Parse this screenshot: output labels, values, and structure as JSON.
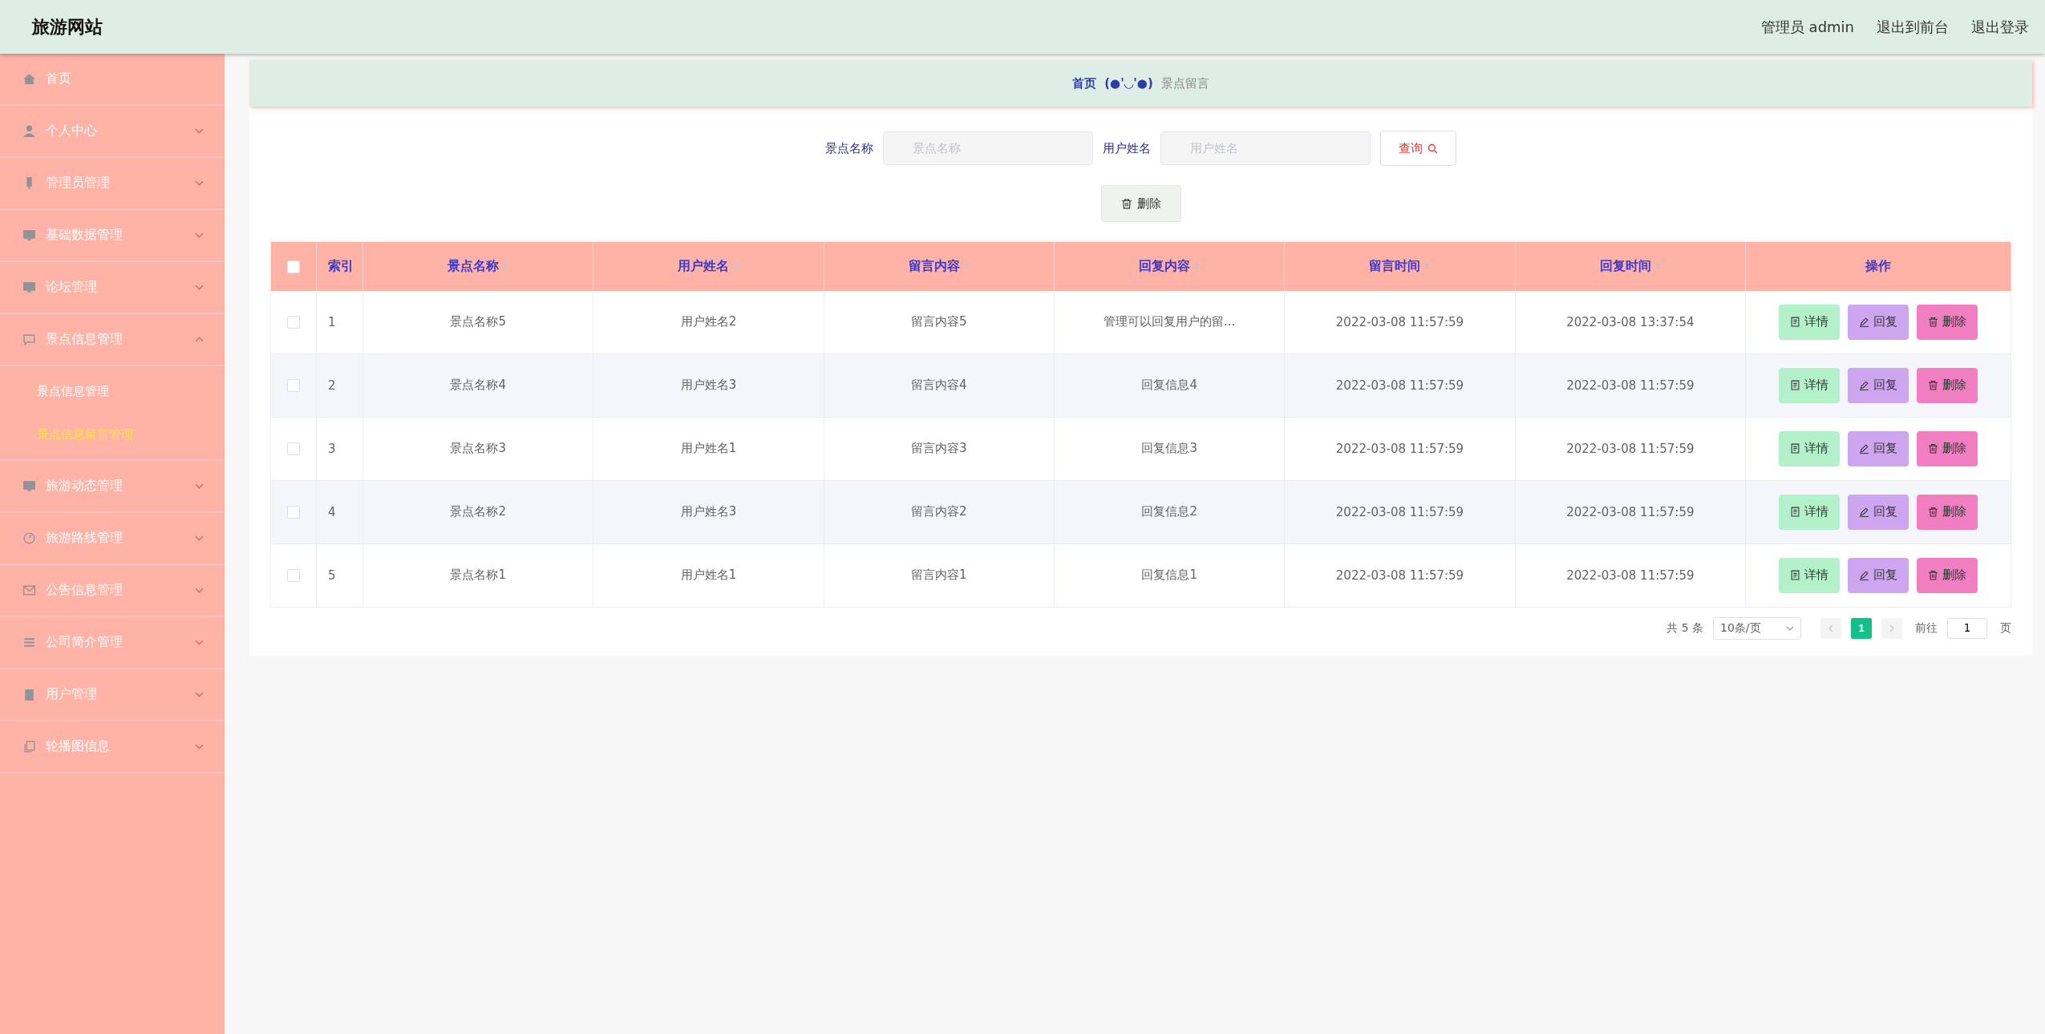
{
  "header": {
    "title": "旅游网站",
    "user": "管理员 admin",
    "links": [
      "退出到前台",
      "退出登录"
    ]
  },
  "sidebar": {
    "items": [
      {
        "label": "首页",
        "kind": "link"
      },
      {
        "label": "个人中心",
        "kind": "menu",
        "expanded": false
      },
      {
        "label": "管理员管理",
        "kind": "menu",
        "expanded": false
      },
      {
        "label": "基础数据管理",
        "kind": "menu",
        "expanded": false
      },
      {
        "label": "论坛管理",
        "kind": "menu",
        "expanded": false
      },
      {
        "label": "景点信息管理",
        "kind": "menu",
        "expanded": true,
        "children": [
          {
            "label": "景点信息管理",
            "selected": false
          },
          {
            "label": "景点信息留言管理",
            "selected": true
          }
        ]
      },
      {
        "label": "旅游动态管理",
        "kind": "menu",
        "expanded": false
      },
      {
        "label": "旅游路线管理",
        "kind": "menu",
        "expanded": false
      },
      {
        "label": "公告信息管理",
        "kind": "menu",
        "expanded": false
      },
      {
        "label": "公司简介管理",
        "kind": "menu",
        "expanded": false
      },
      {
        "label": "用户管理",
        "kind": "menu",
        "expanded": false
      },
      {
        "label": "轮播图信息",
        "kind": "menu",
        "expanded": false
      }
    ]
  },
  "breadcrumb": {
    "home": "首页",
    "separator": "(●'◡'●)",
    "current": "景点留言"
  },
  "search": {
    "fields": [
      {
        "label": "景点名称",
        "placeholder": "景点名称"
      },
      {
        "label": "用户姓名",
        "placeholder": "用户姓名"
      }
    ],
    "button": "查询"
  },
  "delete_button": "删除",
  "table": {
    "select_all": {
      "checked": false
    },
    "columns": [
      {
        "label": "索引",
        "sortable": false
      },
      {
        "label": "景点名称",
        "sortable": true
      },
      {
        "label": "用户姓名",
        "sortable": true
      },
      {
        "label": "留言内容",
        "sortable": true
      },
      {
        "label": "回复内容",
        "sortable": true
      },
      {
        "label": "留言时间",
        "sortable": true
      },
      {
        "label": "回复时间",
        "sortable": true
      },
      {
        "label": "操作",
        "sortable": false
      }
    ],
    "rows": [
      {
        "checked": false,
        "cells": [
          "1",
          "景点名称5",
          "用户姓名2",
          "留言内容5",
          "管理可以回复用户的留...",
          "2022-03-08 11:57:59",
          "2022-03-08 13:37:54"
        ],
        "actions": [
          "详情",
          "回复",
          "删除"
        ]
      },
      {
        "checked": false,
        "cells": [
          "2",
          "景点名称4",
          "用户姓名3",
          "留言内容4",
          "回复信息4",
          "2022-03-08 11:57:59",
          "2022-03-08 11:57:59"
        ],
        "actions": [
          "详情",
          "回复",
          "删除"
        ]
      },
      {
        "checked": false,
        "cells": [
          "3",
          "景点名称3",
          "用户姓名1",
          "留言内容3",
          "回复信息3",
          "2022-03-08 11:57:59",
          "2022-03-08 11:57:59"
        ],
        "actions": [
          "详情",
          "回复",
          "删除"
        ]
      },
      {
        "checked": false,
        "cells": [
          "4",
          "景点名称2",
          "用户姓名3",
          "留言内容2",
          "回复信息2",
          "2022-03-08 11:57:59",
          "2022-03-08 11:57:59"
        ],
        "actions": [
          "详情",
          "回复",
          "删除"
        ]
      },
      {
        "checked": false,
        "cells": [
          "5",
          "景点名称1",
          "用户姓名1",
          "留言内容1",
          "回复信息1",
          "2022-03-08 11:57:59",
          "2022-03-08 11:57:59"
        ],
        "actions": [
          "详情",
          "回复",
          "删除"
        ]
      }
    ]
  },
  "pagination": {
    "total": "共 5 条",
    "page_size": "10条/页",
    "pages": [
      {
        "label": "1",
        "selected": true
      }
    ],
    "goto_label": "前往",
    "goto_value": "1",
    "goto_suffix": "页"
  }
}
